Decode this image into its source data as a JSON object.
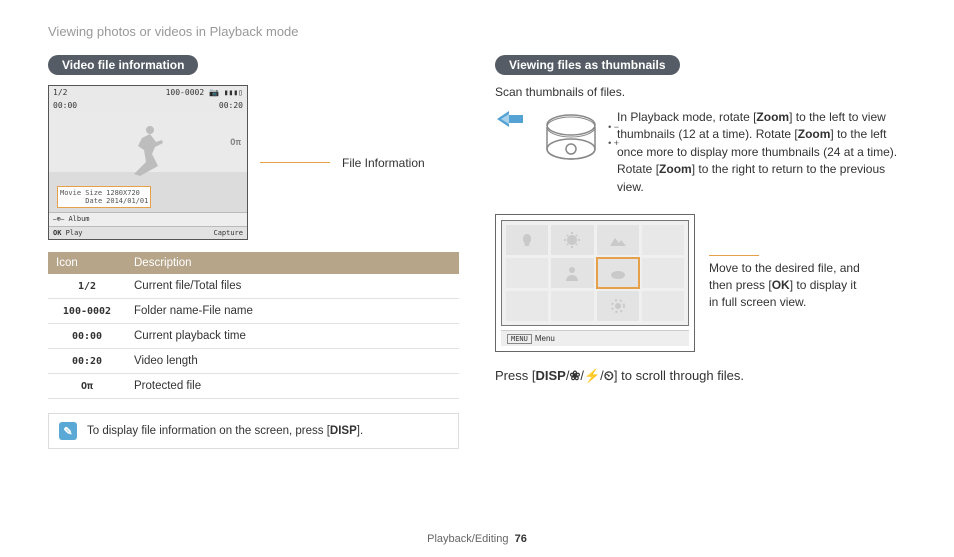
{
  "pageTitle": "Viewing photos or videos in Playback mode",
  "left": {
    "heading": "Video file information",
    "lcd": {
      "topLeft": "1/2",
      "topRight": "100-0002 📷 ▮▮▮▯",
      "timeLeft": "00:00",
      "timeRight": "00:20",
      "lock": "Oπ",
      "infoLabel1": "Movie Size",
      "infoLabel2": "Date",
      "infoValue1": "1280X720",
      "infoValue2": "2014/01/01",
      "album": "Album",
      "play": "Play",
      "capture": "Capture",
      "ok": "OK",
      "albumIcon": "⎯⊕⎯"
    },
    "callout": "File Information",
    "table": {
      "h1": "Icon",
      "h2": "Description",
      "rows": [
        {
          "icon": "1/2",
          "desc": "Current file/Total files"
        },
        {
          "icon": "100-0002",
          "desc": "Folder name-File name"
        },
        {
          "icon": "00:00",
          "desc": "Current playback time"
        },
        {
          "icon": "00:20",
          "desc": "Video length"
        },
        {
          "icon": "Oπ",
          "desc": "Protected file"
        }
      ]
    },
    "note": {
      "pre": "To display file information on the screen, press [",
      "disp": "DISP",
      "post": "]."
    }
  },
  "right": {
    "heading": "Viewing files as thumbnails",
    "sub": "Scan thumbnails of files.",
    "zoom": {
      "p1a": "In Playback mode, rotate [",
      "z1": "Zoom",
      "p1b": "] to the left to view thumbnails (12 at a time). Rotate [",
      "z2": "Zoom",
      "p1c": "] to the left once more to display more thumbnails (24 at a time). Rotate [",
      "z3": "Zoom",
      "p1d": "] to the right to return to the previous view.",
      "minus": "• −",
      "plus": "• +"
    },
    "thumbCallout": {
      "l1": "Move to the desired file, and",
      "l2a": "then press [",
      "ok": "OK",
      "l2b": "] to display it",
      "l3": "in full screen view."
    },
    "thumbMenu": {
      "btn": "MENU",
      "label": "Menu"
    },
    "press": {
      "pre": "Press [",
      "disp": "DISP",
      "sep1": "/",
      "s1": "❀",
      "sep2": "/",
      "s2": "⚡",
      "sep3": "/",
      "s3": "⏲",
      "post": "] to scroll through files."
    }
  },
  "footer": {
    "section": "Playback/Editing",
    "page": "76"
  }
}
